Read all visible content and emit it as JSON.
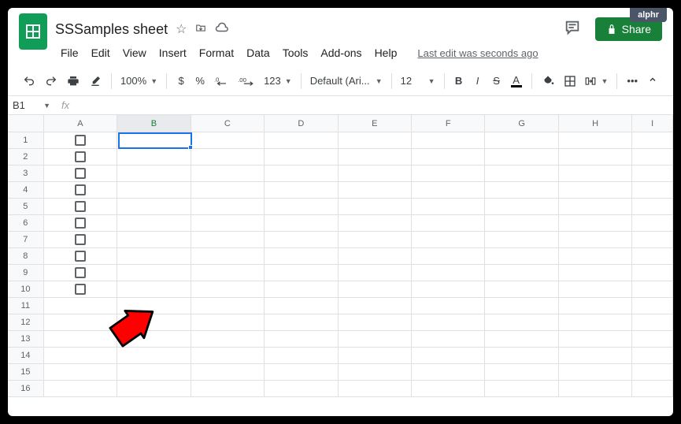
{
  "watermark": "alphr",
  "doc": {
    "title": "SSSamples sheet"
  },
  "share_label": "Share",
  "menus": {
    "file": "File",
    "edit": "Edit",
    "view": "View",
    "insert": "Insert",
    "format": "Format",
    "data": "Data",
    "tools": "Tools",
    "addons": "Add-ons",
    "help": "Help"
  },
  "last_edit": "Last edit was seconds ago",
  "toolbar": {
    "zoom": "100%",
    "currency": "$",
    "percent": "%",
    "dec_minus": ".0",
    "dec_plus": ".00",
    "more_formats": "123",
    "font": "Default (Ari...",
    "font_size": "12",
    "more": "•••"
  },
  "namebox": {
    "cell": "B1"
  },
  "formula": {
    "label": "fx",
    "value": ""
  },
  "columns": [
    "A",
    "B",
    "C",
    "D",
    "E",
    "F",
    "G",
    "H",
    "I"
  ],
  "rows": [
    "1",
    "2",
    "3",
    "4",
    "5",
    "6",
    "7",
    "8",
    "9",
    "10",
    "11",
    "12",
    "13",
    "14",
    "15",
    "16"
  ],
  "checkbox_rows": [
    1,
    2,
    3,
    4,
    5,
    6,
    7,
    8,
    9,
    10
  ],
  "selection": {
    "col": "B",
    "row": 1
  }
}
